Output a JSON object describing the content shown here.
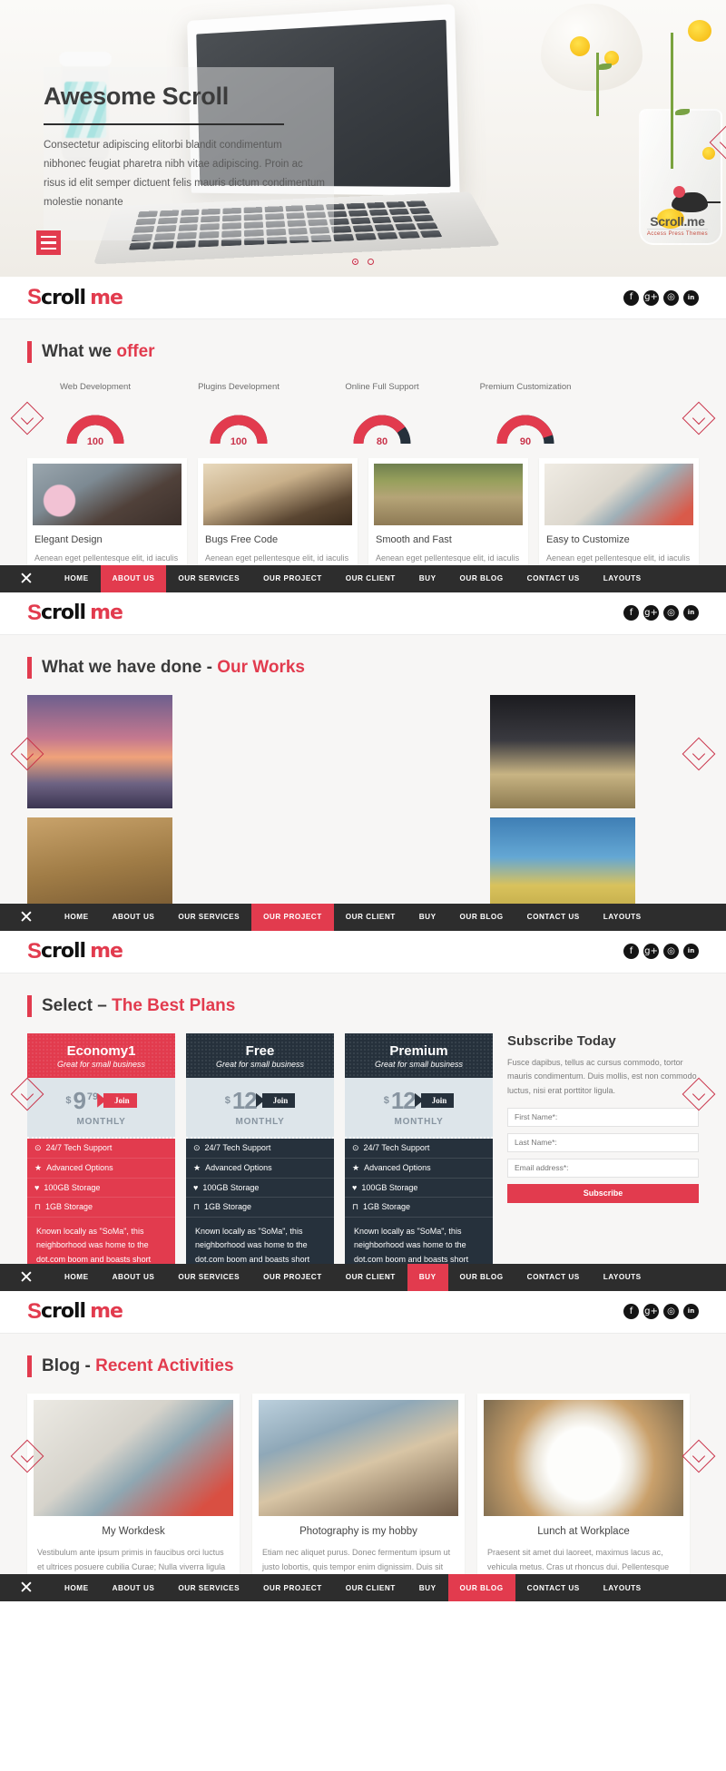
{
  "hero": {
    "title": "Awesome Scroll",
    "description": "Consectetur adipiscing elitorbi blandit condimentum nibhonec feugiat pharetra nibh vitae adipiscing. Proin ac risus id elit semper dictuent felis mauris dictum condimentum molestie nonante",
    "watermark_brand": "Scroll.me",
    "watermark_sub": "Access Press Themes",
    "menu_toggle": "hamburger-menu",
    "slider_dots": 2,
    "active_dot": 1
  },
  "brand": {
    "mark": "S",
    "name_dark": "croll",
    "name_red": "me"
  },
  "socials": [
    {
      "name": "facebook",
      "glyph": "f"
    },
    {
      "name": "google-plus",
      "glyph": "g+"
    },
    {
      "name": "instagram",
      "glyph": "◎"
    },
    {
      "name": "linkedin",
      "glyph": "in"
    }
  ],
  "nav": {
    "close_label": "✕",
    "items": [
      {
        "label": "HOME",
        "active": false
      },
      {
        "label": "ABOUT US",
        "active": false
      },
      {
        "label": "OUR SERVICES",
        "active": false
      },
      {
        "label": "OUR PROJECT",
        "active": false
      },
      {
        "label": "OUR CLIENT",
        "active": false
      },
      {
        "label": "BUY",
        "active": false
      },
      {
        "label": "OUR BLOG",
        "active": false
      },
      {
        "label": "CONTACT US",
        "active": false
      },
      {
        "label": "LAYOUTS",
        "active": false
      }
    ],
    "active_per_section": [
      "ABOUT US",
      "OUR PROJECT",
      "BUY",
      "OUR BLOG"
    ]
  },
  "offer": {
    "title_plain": "What we ",
    "title_accent": "offer",
    "skills": [
      {
        "label": "Web Development",
        "value": 100
      },
      {
        "label": "Plugins Development",
        "value": 100
      },
      {
        "label": "Online Full Support",
        "value": 80
      },
      {
        "label": "Premium Customization",
        "value": 90
      }
    ],
    "features": [
      {
        "title": "Elegant Design",
        "text": "Aenean eget pellentesque elit, id iaculis massa quisque"
      },
      {
        "title": "Bugs Free Code",
        "text": "Aenean eget pellentesque elit, id iaculis massa quisque"
      },
      {
        "title": "Smooth and Fast",
        "text": "Aenean eget pellentesque elit, id iaculis massa quisque"
      },
      {
        "title": "Easy to Customize",
        "text": "Aenean eget pellentesque elit, id iaculis massa quisque"
      }
    ]
  },
  "works": {
    "title_plain": "What we have done - ",
    "title_accent": "Our Works",
    "tiles": [
      {
        "name": "boats-at-sunset"
      },
      {
        "name": "nuts-in-basket"
      },
      {
        "name": "popcorn-bucket"
      },
      {
        "name": "chess-pieces"
      },
      {
        "name": "field-with-flag"
      }
    ]
  },
  "pricing": {
    "title_plain": "Select – ",
    "title_accent": "The Best Plans",
    "plans": [
      {
        "name": "Economy1",
        "tagline": "Great for small business",
        "currency": "$",
        "amount": "9",
        "cents": "79",
        "join_label": "Join",
        "period": "MONTHLY",
        "theme": "red",
        "features": [
          {
            "icon": "clock-icon",
            "glyph": "⊙",
            "label": "24/7 Tech Support"
          },
          {
            "icon": "star-icon",
            "glyph": "★",
            "label": "Advanced Options"
          },
          {
            "icon": "heart-icon",
            "glyph": "♥",
            "label": "100GB Storage"
          },
          {
            "icon": "cart-icon",
            "glyph": "⊓",
            "label": "1GB Storage"
          }
        ],
        "note": "Known locally as \"SoMa\", this neighborhood was home to the dot.com boom and boasts short blocks and gritty."
      },
      {
        "name": "Free",
        "tagline": "Great for small business",
        "currency": "$",
        "amount": "12",
        "cents": "",
        "join_label": "Join",
        "period": "MONTHLY",
        "theme": "dark",
        "features": [
          {
            "icon": "clock-icon",
            "glyph": "⊙",
            "label": "24/7 Tech Support"
          },
          {
            "icon": "star-icon",
            "glyph": "★",
            "label": "Advanced Options"
          },
          {
            "icon": "heart-icon",
            "glyph": "♥",
            "label": "100GB Storage"
          },
          {
            "icon": "cart-icon",
            "glyph": "⊓",
            "label": "1GB Storage"
          }
        ],
        "note": "Known locally as \"SoMa\", this neighborhood was home to the dot.com boom and boasts short blocks and gritty."
      },
      {
        "name": "Premium",
        "tagline": "Great for small business",
        "currency": "$",
        "amount": "12",
        "cents": "",
        "join_label": "Join",
        "period": "MONTHLY",
        "theme": "dark",
        "features": [
          {
            "icon": "clock-icon",
            "glyph": "⊙",
            "label": "24/7 Tech Support"
          },
          {
            "icon": "star-icon",
            "glyph": "★",
            "label": "Advanced Options"
          },
          {
            "icon": "heart-icon",
            "glyph": "♥",
            "label": "100GB Storage"
          },
          {
            "icon": "cart-icon",
            "glyph": "⊓",
            "label": "1GB Storage"
          }
        ],
        "note": "Known locally as \"SoMa\", this neighborhood was home to the dot.com boom and boasts short blocks and gritty."
      }
    ],
    "subscribe": {
      "title": "Subscribe Today",
      "text": "Fusce dapibus, tellus ac cursus commodo, tortor mauris condimentum. Duis mollis, est non commodo luctus, nisi erat porttitor ligula.",
      "first_name_placeholder": "First Name*:",
      "last_name_placeholder": "Last Name*:",
      "email_placeholder": "Email address*:",
      "button_label": "Subscribe"
    }
  },
  "blog": {
    "title_plain": "Blog - ",
    "title_accent": "Recent Activities",
    "posts": [
      {
        "title": "My Workdesk",
        "text": "Vestibulum ante ipsum primis in faucibus orci luctus et ultrices posuere cubilia Curae; Nulla viverra ligula a nibh rutrum, eu malesuada"
      },
      {
        "title": "Photography is my hobby",
        "text": "Etiam nec aliquet purus. Donec fermentum ipsum ut justo lobortis, quis tempor enim dignissim. Duis sit amet dui laoreet, maximus"
      },
      {
        "title": "Lunch at Workplace",
        "text": "Praesent sit amet dui laoreet, maximus lacus ac, vehicula metus. Cras ut rhoncus dui. Pellentesque habitant morbi tristique senectus"
      }
    ]
  },
  "colors": {
    "accent": "#e23b4e",
    "accent_dark": "#c9334a",
    "nav_bg": "#2d2d2d",
    "panel_bg": "#f7f6f5",
    "plan_dark": "#26313c",
    "price_bg": "#dde5ea"
  }
}
